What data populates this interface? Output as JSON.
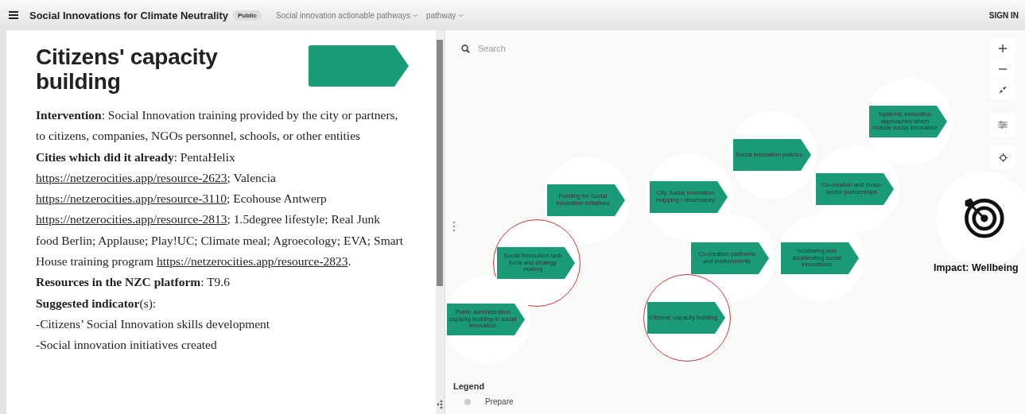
{
  "header": {
    "title": "Social Innovations for Climate Neutrality",
    "badge": "Public",
    "dropdowns": [
      {
        "label": "Social innovation actionable pathways"
      },
      {
        "label": "pathway"
      }
    ],
    "sign_in": "SIGN IN"
  },
  "panel": {
    "title": "Citizens' capacity building",
    "paragraphs": [
      [
        {
          "kind": "bold",
          "text": "Intervention"
        },
        {
          "kind": "text",
          "text": ": Social Innovation training provided by the city or partners, to citizens, companies, NGOs personnel, schools, or other entities"
        }
      ],
      [
        {
          "kind": "bold",
          "text": "Cities which did it already"
        },
        {
          "kind": "text",
          "text": ": PentaHelix "
        },
        {
          "kind": "link",
          "text": "https://netzerocities.app/resource-2623"
        },
        {
          "kind": "text",
          "text": "; Valencia "
        },
        {
          "kind": "link",
          "text": "https://netzerocities.app/resource-3110"
        },
        {
          "kind": "text",
          "text": "; Ecohouse Antwerp "
        },
        {
          "kind": "link",
          "text": "https://netzerocities.app/resource-2813"
        },
        {
          "kind": "text",
          "text": "; 1.5degree lifestyle; Real Junk food Berlin; Applause; Play!UC; Climate meal; Agroecology; EVA; Smart House training program "
        },
        {
          "kind": "link",
          "text": "https://netzerocities.app/resource-2823"
        },
        {
          "kind": "text",
          "text": "."
        }
      ],
      [
        {
          "kind": "bold",
          "text": "Resources in the NZC platform"
        },
        {
          "kind": "text",
          "text": ": T9.6"
        }
      ],
      [
        {
          "kind": "bold",
          "text": "Suggested indicator"
        },
        {
          "kind": "text",
          "text": "(s):"
        }
      ],
      [
        {
          "kind": "text",
          "text": "-Citizens’ Social Innovation skills development"
        }
      ],
      [
        {
          "kind": "text",
          "text": "-Social innovation initiatives created"
        }
      ]
    ]
  },
  "map": {
    "search": {
      "placeholder": "Search"
    },
    "nodes": [
      {
        "label": "Systemic innovation approaches which include social innovation",
        "highlighted": false
      },
      {
        "label": "Social innovation policies",
        "highlighted": false
      },
      {
        "label": "Co-creation and cross-sector partnerships",
        "highlighted": false
      },
      {
        "label": "Funding for Social Innovation initiatives",
        "highlighted": false
      },
      {
        "label": "City Social Innovation mapping / observatory",
        "highlighted": false
      },
      {
        "label": "Social Innovation task force and strategy making",
        "highlighted": true
      },
      {
        "label": "Co-creation platforms and environments",
        "highlighted": false
      },
      {
        "label": "Incubating and accelerating social innovations",
        "highlighted": false
      },
      {
        "label": "Public administration capacity building in social innovation",
        "highlighted": false
      },
      {
        "label": "Citizens' capacity building",
        "highlighted": true
      }
    ],
    "impact": {
      "label": "Impact: Wellbeing"
    },
    "legend": {
      "title": "Legend",
      "items": [
        {
          "label": "Prepare",
          "color": "#cccccc"
        }
      ]
    }
  }
}
